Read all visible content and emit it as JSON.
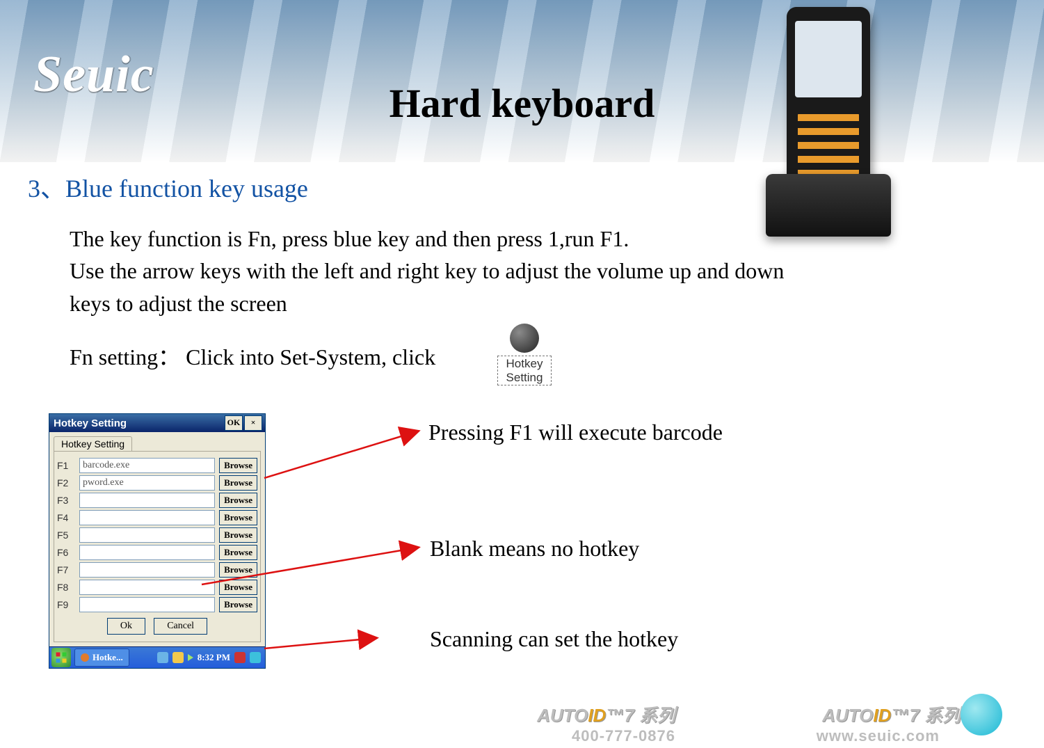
{
  "brand": "Seuic",
  "page_title": "Hard keyboard",
  "section_heading": "3、Blue function key usage",
  "body_para": "The key function is Fn, press blue key and then press 1,run F1.\nUse the arrow keys with the left and right key to adjust the volume up and down keys to adjust the screen",
  "fn_line": "Fn setting： Click into Set-System, click",
  "hotkey_icon_label": "Hotkey Setting",
  "dialog": {
    "title": "Hotkey Setting",
    "ok_btn": "OK",
    "close_btn": "×",
    "tab_label": "Hotkey Setting",
    "browse_label": "Browse",
    "rows": [
      {
        "key": "F1",
        "value": "barcode.exe"
      },
      {
        "key": "F2",
        "value": "pword.exe"
      },
      {
        "key": "F3",
        "value": ""
      },
      {
        "key": "F4",
        "value": ""
      },
      {
        "key": "F5",
        "value": ""
      },
      {
        "key": "F6",
        "value": ""
      },
      {
        "key": "F7",
        "value": ""
      },
      {
        "key": "F8",
        "value": ""
      },
      {
        "key": "F9",
        "value": ""
      }
    ],
    "ok": "Ok",
    "cancel": "Cancel"
  },
  "taskbar": {
    "task_label": "Hotke...",
    "time": "8:32 PM"
  },
  "annotations": {
    "a1": "Pressing F1 will execute barcode",
    "a2": "Blank means no hotkey",
    "a3": "Scanning can set the hotkey"
  },
  "footer": {
    "product": "AUTOID™7 系列",
    "phone": "400-777-0876",
    "url": "www.seuic.com"
  }
}
